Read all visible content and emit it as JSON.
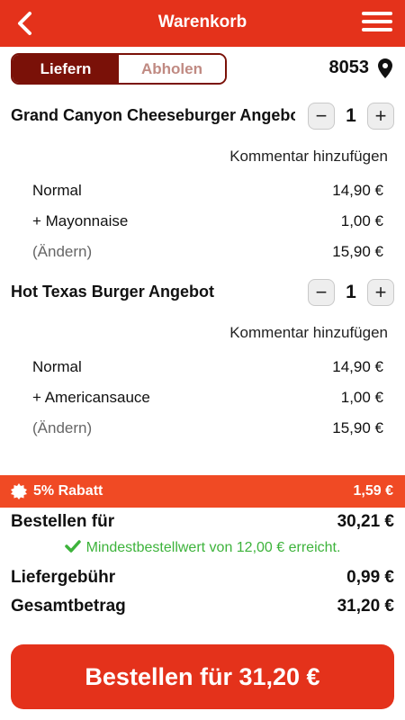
{
  "header": {
    "title": "Warenkorb"
  },
  "mode": {
    "delivery": "Liefern",
    "pickup": "Abholen"
  },
  "location": {
    "plz": "8053"
  },
  "items": [
    {
      "name": "Grand Canyon Cheeseburger Angebot",
      "qty": "1",
      "comment": "Kommentar hinzufügen",
      "lines": [
        {
          "label": "Normal",
          "price": "14,90 €"
        },
        {
          "label": "+ Mayonnaise",
          "price": "1,00 €"
        },
        {
          "label": "(Ändern)",
          "price": "15,90 €"
        }
      ]
    },
    {
      "name": "Hot Texas Burger Angebot",
      "qty": "1",
      "comment": "Kommentar hinzufügen",
      "lines": [
        {
          "label": "Normal",
          "price": "14,90 €"
        },
        {
          "label": "+ Americansauce",
          "price": "1,00 €"
        },
        {
          "label": "(Ändern)",
          "price": "15,90 €"
        }
      ]
    }
  ],
  "qty_controls": {
    "minus": "−",
    "plus": "+"
  },
  "discount": {
    "label": "5% Rabatt",
    "value": "1,59 €"
  },
  "summary": {
    "order_for_label": "Bestellen für",
    "order_for_value": "30,21 €",
    "min_order_note": "Mindestbestellwert von 12,00 € erreicht.",
    "delivery_fee_label": "Liefergebühr",
    "delivery_fee_value": "0,99 €",
    "total_label": "Gesamtbetrag",
    "total_value": "31,20 €"
  },
  "cta": {
    "label": "Bestellen für 31,20 €"
  },
  "colors": {
    "brand": "#e4321b",
    "dark": "#7a1108",
    "discount": "#f04a24",
    "success": "#3db33b"
  }
}
